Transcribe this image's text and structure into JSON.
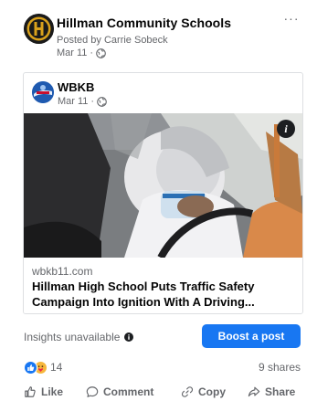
{
  "post": {
    "page_name": "Hillman Community Schools",
    "posted_by": "Posted by Carrie Sobeck",
    "date": "Mar 11",
    "separator": "·",
    "more_label": "···"
  },
  "shared": {
    "source_name": "WBKB",
    "date": "Mar 11",
    "separator": "·",
    "domain": "wbkb11.com",
    "title": "Hillman High School Puts Traffic Safety Campaign Into Ignition With A Driving...",
    "info_label": "i"
  },
  "insights": {
    "text": "Insights unavailable",
    "boost_label": "Boost a post"
  },
  "engagement": {
    "reaction_count": "14",
    "shares": "9 shares"
  },
  "actions": {
    "like": "Like",
    "comment": "Comment",
    "copy": "Copy",
    "share": "Share"
  },
  "colors": {
    "accent": "#1877f2",
    "secondary_text": "#65676b",
    "primary_text": "#050505"
  },
  "icons": {
    "globe": "globe-icon",
    "info": "info-icon",
    "like": "thumbs-up-icon",
    "comment": "comment-bubble-icon",
    "copy": "link-icon",
    "share": "share-arrow-icon"
  }
}
